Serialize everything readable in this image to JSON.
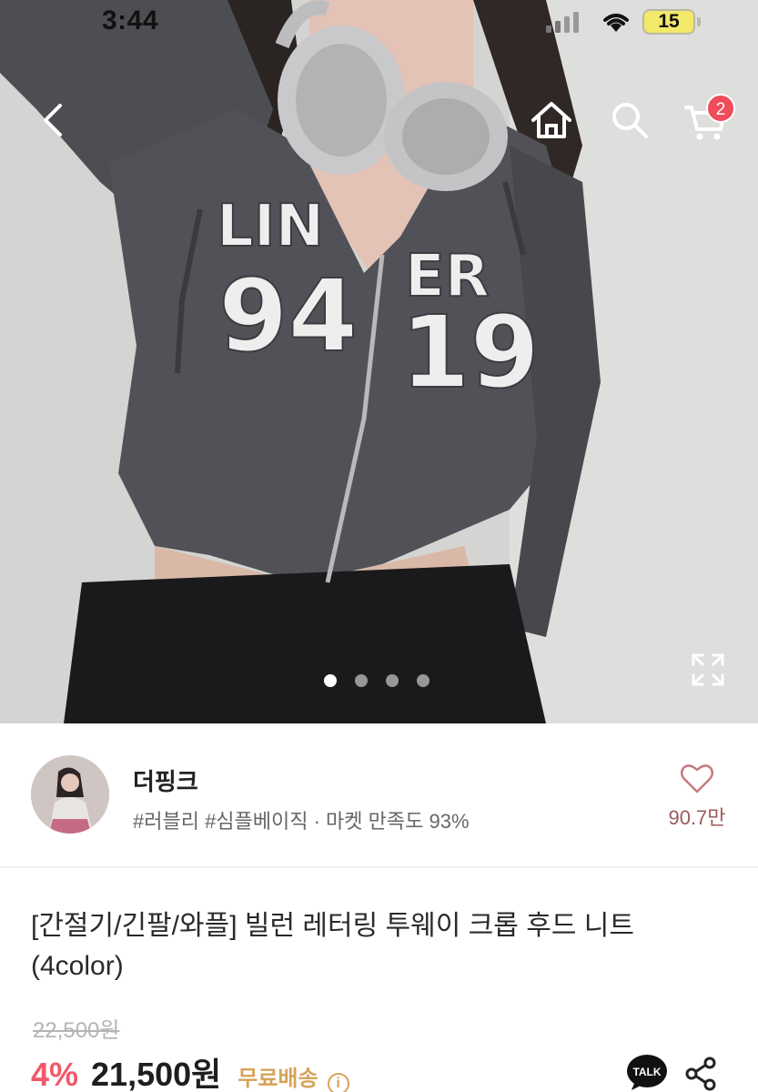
{
  "status_bar": {
    "time": "3:44",
    "battery": "15"
  },
  "header": {
    "cart_count": "2",
    "icons": [
      "chevron-left-icon",
      "home-icon",
      "search-icon",
      "cart-icon"
    ]
  },
  "hero": {
    "image_count": 4,
    "active_index": 0,
    "print_text": [
      "LIN",
      "94",
      "ER",
      "19"
    ]
  },
  "seller": {
    "name": "더핑크",
    "tags": "#러블리 #심플베이직 · 마켓 만족도 93%",
    "likes": "90.7만"
  },
  "product": {
    "title": "[간절기/긴팔/와플] 빌런 레터링 투웨이 크롭 후드 니트 (4color)",
    "original_price": "22,500원",
    "discount": "4%",
    "price": "21,500원",
    "shipping": "무료배송",
    "info_glyph": "i",
    "talk_label": "TALK"
  },
  "colors": {
    "badge": "#ef4b5b",
    "discount": "#ef5a6a",
    "shipping": "#d6a35a",
    "likes": "#9d5a5a"
  }
}
